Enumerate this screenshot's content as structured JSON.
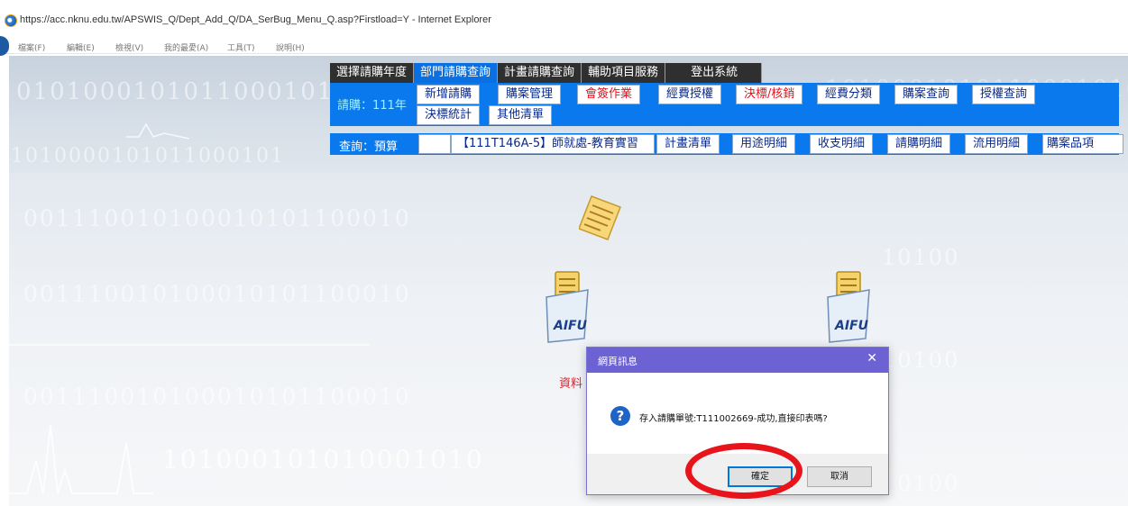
{
  "browser": {
    "title": "https://acc.nknu.edu.tw/APSWIS_Q/Dept_Add_Q/DA_SerBug_Menu_Q.asp?Firstload=Y - Internet Explorer",
    "menu": [
      "檔案(F)",
      "編輯(E)",
      "檢視(V)",
      "我的最愛(A)",
      "工具(T)",
      "說明(H)"
    ]
  },
  "nav": {
    "tabs": [
      "選擇請購年度",
      "部門請購查詢",
      "計畫請購查詢",
      "輔助項目服務",
      "登出系統"
    ],
    "active_tab": "部門請購查詢"
  },
  "purchase_row": {
    "label": "請購：111年",
    "buttons_top": [
      "新增請購",
      "購案管理",
      "會簽作業",
      "經費授權",
      "決標/核銷",
      "經費分類",
      "購案查詢",
      "授權查詢"
    ],
    "buttons_bottom": [
      "決標統計",
      "其他清單"
    ],
    "red_buttons": [
      "會簽作業",
      "決標/核銷"
    ]
  },
  "query_row": {
    "label": "查詢：預算",
    "plan_value": "【111T146A-5】師就處-教育實習",
    "buttons": [
      "計畫清單",
      "用途明細",
      "收支明細",
      "請購明細",
      "流用明細",
      "購案品項"
    ]
  },
  "background": {
    "binary_lines": [
      "0101000101011000101",
      "1010000101011000101",
      "1010001010110001010",
      "001110010100010101100010",
      "001110010100010101100010",
      "001110010100010101100010",
      "10100",
      "101000101010001010",
      "10100",
      "10100",
      "10100",
      "10100",
      "100",
      "101000101010001010100010"
    ]
  },
  "page": {
    "resource_text": "資料"
  },
  "dialog": {
    "title": "網頁訊息",
    "close": "✕",
    "icon": "?",
    "message": "存入請購單號:T111002669-成功,直接印表嗎?",
    "ok_label": "確定",
    "cancel_label": "取消"
  }
}
